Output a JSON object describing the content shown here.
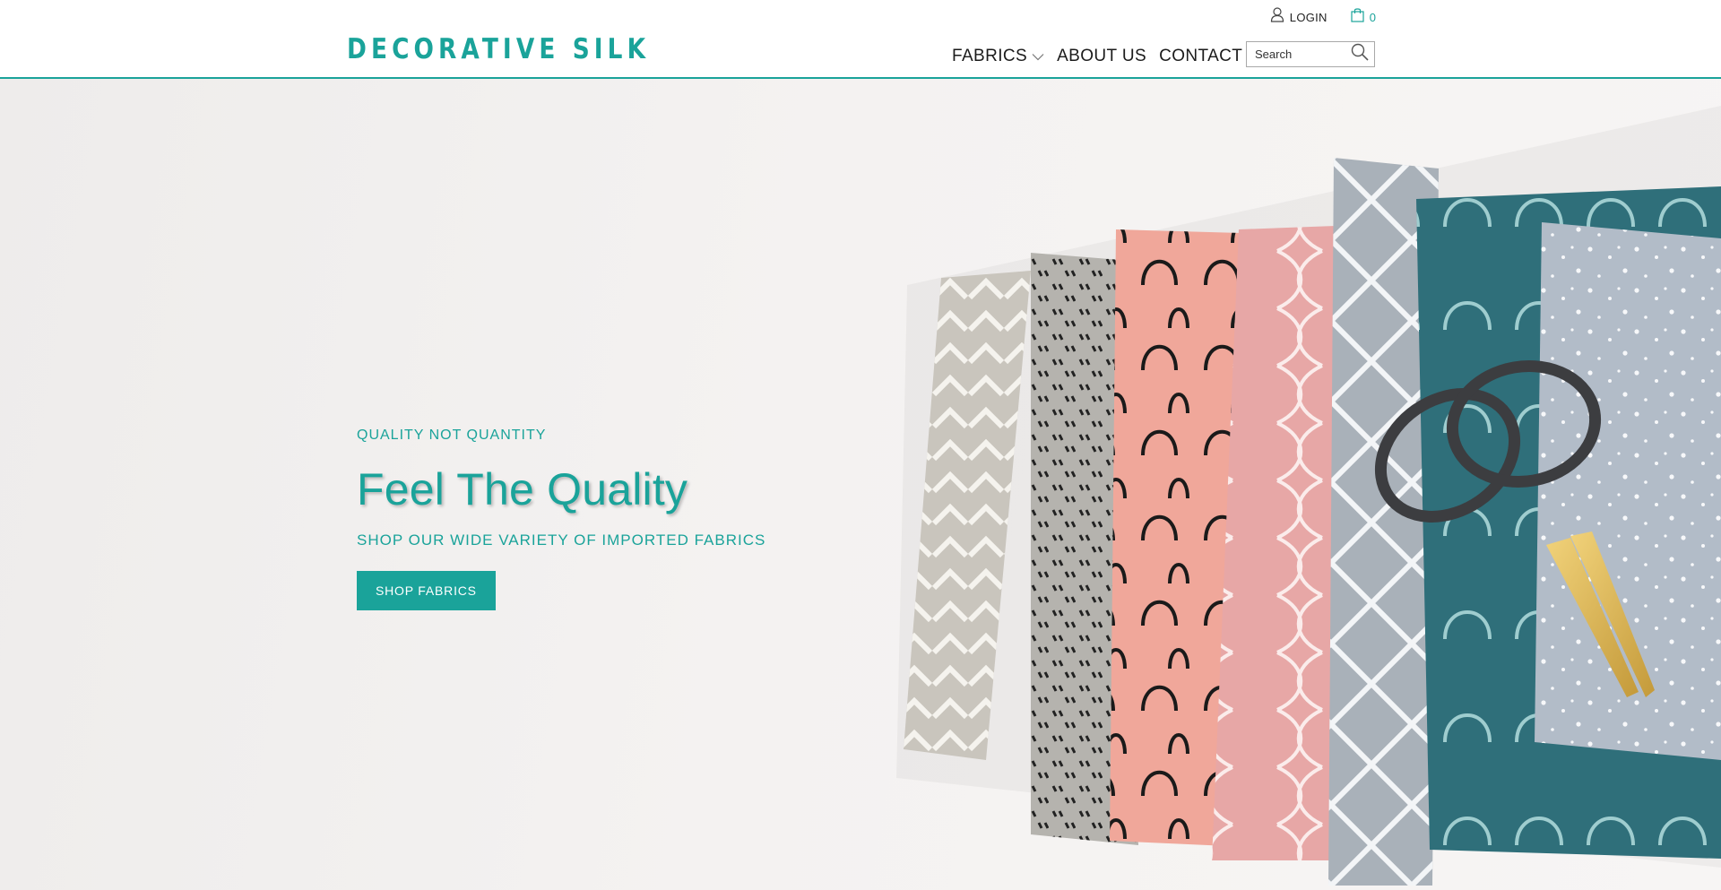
{
  "brand": {
    "logo_text": "DECORATIVE SILK",
    "accent_color": "#1aa39a"
  },
  "utility": {
    "login_label": "LOGIN",
    "login_icon": "user-icon",
    "cart_icon": "shopping-bag-icon",
    "cart_count": "0"
  },
  "nav": {
    "items": [
      {
        "label": "FABRICS",
        "has_dropdown": true
      },
      {
        "label": "ABOUT US"
      },
      {
        "label": "CONTACT"
      }
    ]
  },
  "search": {
    "placeholder": "Search",
    "icon": "search-icon"
  },
  "hero": {
    "eyebrow": "QUALITY NOT QUANTITY",
    "headline": "Feel The Quality",
    "subhead": "SHOP OUR WIDE VARIETY OF IMPORTED FABRICS",
    "cta_label": "SHOP FABRICS",
    "image": "folded-fabrics-with-scissors"
  }
}
